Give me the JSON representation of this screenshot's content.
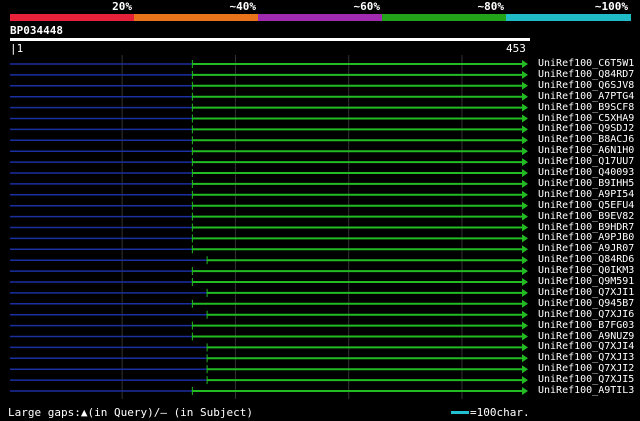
{
  "legend": [
    {
      "label": "20%",
      "color": "#e8213b"
    },
    {
      "label": "~40%",
      "color": "#e8731b"
    },
    {
      "label": "~60%",
      "color": "#a02bb0"
    },
    {
      "label": "~80%",
      "color": "#22a31a"
    },
    {
      "label": "~100%",
      "color": "#1fbcc8"
    }
  ],
  "query": {
    "title": "BP034448",
    "start": "1",
    "end": "453"
  },
  "colors": {
    "hit_line": "#22bb22",
    "gap_line": "#1a2fa0",
    "grid": "#333333",
    "query_bar": "#ffffff",
    "scale_bar": "#22c0d0"
  },
  "hits": [
    {
      "name": "UniRef100_C6T5W1",
      "start": 162,
      "end": 453
    },
    {
      "name": "UniRef100_Q84RD7",
      "start": 162,
      "end": 453
    },
    {
      "name": "UniRef100_Q6SJV8",
      "start": 162,
      "end": 453
    },
    {
      "name": "UniRef100_A7PTG4",
      "start": 162,
      "end": 453
    },
    {
      "name": "UniRef100_B9SCF8",
      "start": 162,
      "end": 453
    },
    {
      "name": "UniRef100_C5XHA9",
      "start": 162,
      "end": 453
    },
    {
      "name": "UniRef100_Q9SDJ2",
      "start": 162,
      "end": 453
    },
    {
      "name": "UniRef100_B8ACJ6",
      "start": 162,
      "end": 453
    },
    {
      "name": "UniRef100_A6N1H0",
      "start": 162,
      "end": 453
    },
    {
      "name": "UniRef100_Q17UU7",
      "start": 162,
      "end": 453
    },
    {
      "name": "UniRef100_Q40093",
      "start": 162,
      "end": 453
    },
    {
      "name": "UniRef100_B9IHH5",
      "start": 162,
      "end": 453
    },
    {
      "name": "UniRef100_A9PI54",
      "start": 162,
      "end": 453
    },
    {
      "name": "UniRef100_Q5EFU4",
      "start": 162,
      "end": 453
    },
    {
      "name": "UniRef100_B9EV82",
      "start": 162,
      "end": 453
    },
    {
      "name": "UniRef100_B9HDR7",
      "start": 162,
      "end": 453
    },
    {
      "name": "UniRef100_A9PJB0",
      "start": 162,
      "end": 453
    },
    {
      "name": "UniRef100_A9JR07",
      "start": 162,
      "end": 453
    },
    {
      "name": "UniRef100_Q84RD6",
      "start": 175,
      "end": 453
    },
    {
      "name": "UniRef100_Q0IKM3",
      "start": 162,
      "end": 453
    },
    {
      "name": "UniRef100_Q9M591",
      "start": 162,
      "end": 453
    },
    {
      "name": "UniRef100_Q7XJI1",
      "start": 175,
      "end": 453
    },
    {
      "name": "UniRef100_Q945B7",
      "start": 162,
      "end": 453
    },
    {
      "name": "UniRef100_Q7XJI6",
      "start": 175,
      "end": 453
    },
    {
      "name": "UniRef100_B7FG03",
      "start": 162,
      "end": 453
    },
    {
      "name": "UniRef100_A9NUZ9",
      "start": 162,
      "end": 453
    },
    {
      "name": "UniRef100_Q7XJI4",
      "start": 175,
      "end": 453
    },
    {
      "name": "UniRef100_Q7XJI3",
      "start": 175,
      "end": 453
    },
    {
      "name": "UniRef100_Q7XJI2",
      "start": 175,
      "end": 453
    },
    {
      "name": "UniRef100_Q7XJI5",
      "start": 175,
      "end": 453
    },
    {
      "name": "UniRef100_A9TIL3",
      "start": 162,
      "end": 453
    }
  ],
  "footer": {
    "gaps_note": "Large gaps:▲(in Query)/– (in Subject)",
    "scale_note": "=100char."
  }
}
